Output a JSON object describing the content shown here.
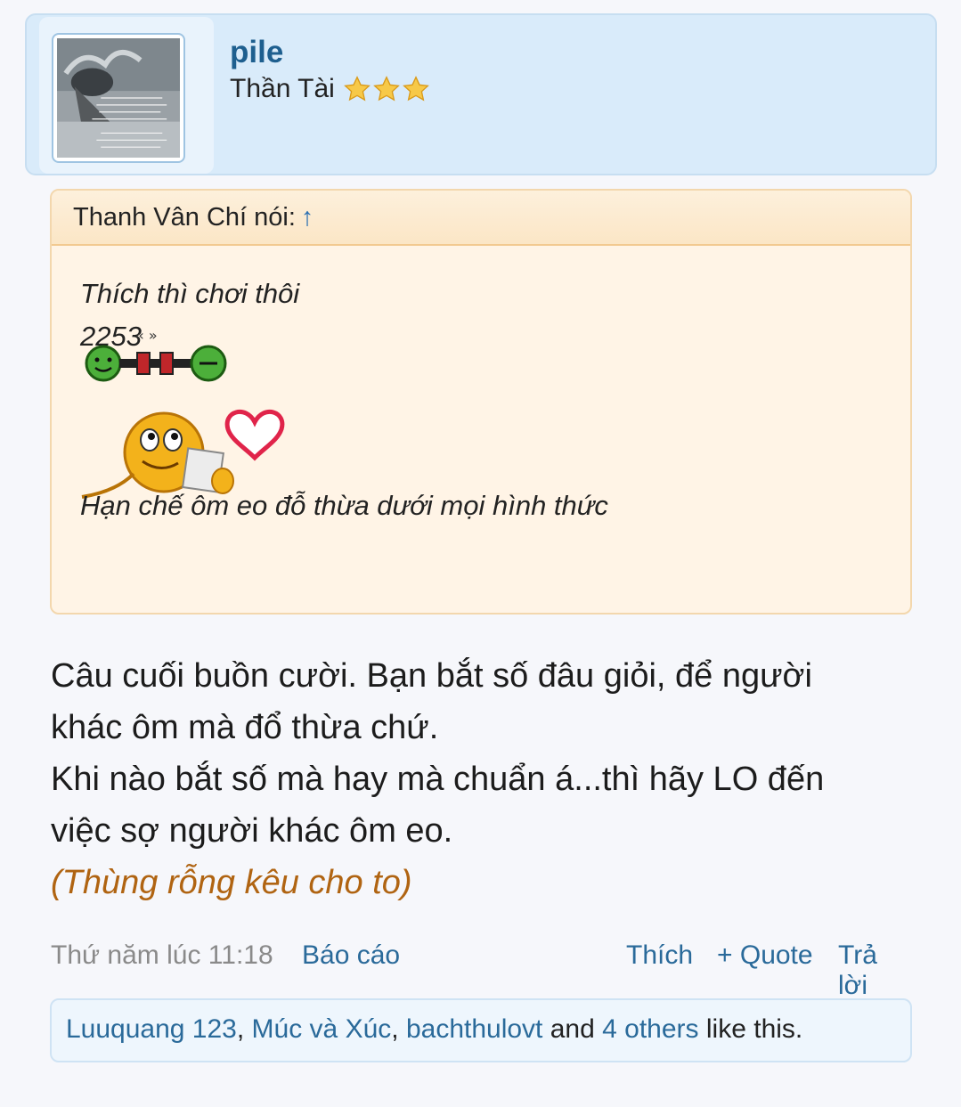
{
  "user": {
    "name": "pile",
    "title": "Thần Tài",
    "stars": 3
  },
  "quote": {
    "author_label": "Thanh Vân Chí nói:",
    "arrow": "↑",
    "line1": "Thích thì chơi thôi",
    "line2": "2253",
    "line3": "Hạn chế ôm eo đỗ thừa dưới mọi hình thức"
  },
  "message": {
    "line1": "Câu cuối buồn cười. Bạn bắt số đâu giỏi, để người",
    "line2": "khác ôm mà đổ thừa chứ.",
    "line3": "Khi nào bắt số mà hay mà chuẩn á...thì hãy LO đến",
    "line4": "việc sợ người khác ôm eo.",
    "highlight": "(Thùng rỗng kêu cho to)"
  },
  "footer": {
    "date": "Thứ năm lúc 11:18",
    "report": "Báo cáo",
    "like": "Thích",
    "quote": "+ Quote",
    "reply": "Trả lời"
  },
  "likes": {
    "user1": "Luuquang 123",
    "sep1": ", ",
    "user2": "Múc và Xúc",
    "sep2": ", ",
    "user3": "bachthulovt",
    "and": " and ",
    "others": "4 others",
    "suffix": " like this."
  },
  "colors": {
    "username": "#1e5f8f",
    "link": "#2a6a9a",
    "highlight": "#b06412",
    "quote_bg": "#fff4e6",
    "card_bg": "#d9ebfa"
  }
}
